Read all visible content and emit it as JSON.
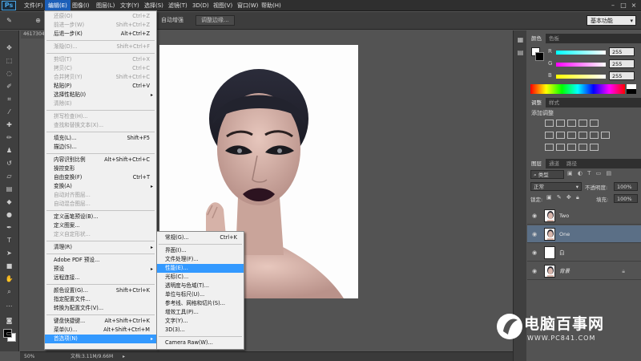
{
  "app": {
    "logo": "Ps"
  },
  "menubar": {
    "items": [
      "文件(F)",
      "编辑(E)",
      "图像(I)",
      "图层(L)",
      "文字(Y)",
      "选择(S)",
      "滤镜(T)",
      "3D(D)",
      "视图(V)",
      "窗口(W)",
      "帮助(H)"
    ],
    "active_index": 1
  },
  "options": {
    "auto_enhance": "自动增强",
    "refine_edge": "调整边缘...",
    "workspace": "基本功能"
  },
  "document": {
    "tab_label": "4617304",
    "zoom": "50%",
    "doc_info": "文档:3.11M/9.66M"
  },
  "edit_menu": [
    {
      "label": "还原(O)",
      "shortcut": "Ctrl+Z",
      "disabled": true
    },
    {
      "label": "前进一步(W)",
      "shortcut": "Shift+Ctrl+Z",
      "disabled": true
    },
    {
      "label": "后退一步(K)",
      "shortcut": "Alt+Ctrl+Z",
      "disabled": false
    },
    {
      "sep": true
    },
    {
      "label": "渐隐(D)...",
      "shortcut": "Shift+Ctrl+F",
      "disabled": true
    },
    {
      "sep": true
    },
    {
      "label": "剪切(T)",
      "shortcut": "Ctrl+X",
      "disabled": true
    },
    {
      "label": "拷贝(C)",
      "shortcut": "Ctrl+C",
      "disabled": true
    },
    {
      "label": "合并拷贝(Y)",
      "shortcut": "Shift+Ctrl+C",
      "disabled": true
    },
    {
      "label": "粘贴(P)",
      "shortcut": "Ctrl+V",
      "disabled": false
    },
    {
      "label": "选择性粘贴(I)",
      "shortcut": "",
      "disabled": false,
      "submenu": true
    },
    {
      "label": "清除(E)",
      "shortcut": "",
      "disabled": true
    },
    {
      "sep": true
    },
    {
      "label": "拼写检查(H)...",
      "shortcut": "",
      "disabled": true
    },
    {
      "label": "查找和替换文本(X)...",
      "shortcut": "",
      "disabled": true
    },
    {
      "sep": true
    },
    {
      "label": "填充(L)...",
      "shortcut": "Shift+F5",
      "disabled": false
    },
    {
      "label": "描边(S)...",
      "shortcut": "",
      "disabled": false
    },
    {
      "sep": true
    },
    {
      "label": "内容识别比例",
      "shortcut": "Alt+Shift+Ctrl+C",
      "disabled": false
    },
    {
      "label": "操控变形",
      "shortcut": "",
      "disabled": false
    },
    {
      "label": "自由变换(F)",
      "shortcut": "Ctrl+T",
      "disabled": false
    },
    {
      "label": "变换(A)",
      "shortcut": "",
      "disabled": false,
      "submenu": true
    },
    {
      "label": "自动对齐图层...",
      "shortcut": "",
      "disabled": true
    },
    {
      "label": "自动混合图层...",
      "shortcut": "",
      "disabled": true
    },
    {
      "sep": true
    },
    {
      "label": "定义画笔预设(B)...",
      "shortcut": "",
      "disabled": false
    },
    {
      "label": "定义图案...",
      "shortcut": "",
      "disabled": false
    },
    {
      "label": "定义自定形状...",
      "shortcut": "",
      "disabled": true
    },
    {
      "sep": true
    },
    {
      "label": "清理(R)",
      "shortcut": "",
      "disabled": false,
      "submenu": true
    },
    {
      "sep": true
    },
    {
      "label": "Adobe PDF 预设...",
      "shortcut": "",
      "disabled": false
    },
    {
      "label": "预设",
      "shortcut": "",
      "disabled": false,
      "submenu": true
    },
    {
      "label": "远程连接...",
      "shortcut": "",
      "disabled": false
    },
    {
      "sep": true
    },
    {
      "label": "颜色设置(G)...",
      "shortcut": "Shift+Ctrl+K",
      "disabled": false
    },
    {
      "label": "指定配置文件...",
      "shortcut": "",
      "disabled": false
    },
    {
      "label": "转换为配置文件(V)...",
      "shortcut": "",
      "disabled": false
    },
    {
      "sep": true
    },
    {
      "label": "键盘快捷键...",
      "shortcut": "Alt+Shift+Ctrl+K",
      "disabled": false
    },
    {
      "label": "菜单(U)...",
      "shortcut": "Alt+Shift+Ctrl+M",
      "disabled": false
    },
    {
      "label": "首选项(N)",
      "shortcut": "",
      "disabled": false,
      "submenu": true,
      "highlight": true
    }
  ],
  "prefs_submenu": [
    {
      "label": "常规(G)...",
      "shortcut": "Ctrl+K"
    },
    {
      "sep": true
    },
    {
      "label": "界面(I)...",
      "shortcut": ""
    },
    {
      "label": "文件处理(F)...",
      "shortcut": ""
    },
    {
      "label": "性能(E)...",
      "shortcut": "",
      "highlight": true
    },
    {
      "label": "光标(C)...",
      "shortcut": ""
    },
    {
      "label": "透明度与色域(T)...",
      "shortcut": ""
    },
    {
      "label": "单位与标尺(U)...",
      "shortcut": ""
    },
    {
      "label": "参考线、网格和切片(S)...",
      "shortcut": ""
    },
    {
      "label": "增效工具(P)...",
      "shortcut": ""
    },
    {
      "label": "文字(Y)...",
      "shortcut": ""
    },
    {
      "label": "3D(3)...",
      "shortcut": ""
    },
    {
      "sep": true
    },
    {
      "label": "Camera Raw(W)...",
      "shortcut": ""
    }
  ],
  "color_panel": {
    "tabs": [
      "颜色",
      "色板"
    ],
    "channels": [
      {
        "name": "R",
        "value": "255"
      },
      {
        "name": "G",
        "value": "255"
      },
      {
        "name": "B",
        "value": "255"
      }
    ]
  },
  "adjust_panel": {
    "tabs": [
      "调整",
      "样式"
    ],
    "title": "添加调整"
  },
  "layers_panel": {
    "tabs": [
      "图层",
      "通道",
      "路径"
    ],
    "filter_kind": "类型",
    "blend_mode": "正常",
    "opacity_label": "不透明度:",
    "opacity": "100%",
    "lock_label": "锁定:",
    "fill_label": "填充:",
    "fill": "100%",
    "layers": [
      {
        "name": "Two",
        "selected": false,
        "locked": false,
        "italic": false
      },
      {
        "name": "One",
        "selected": true,
        "locked": false,
        "italic": false
      },
      {
        "name": "白",
        "selected": false,
        "locked": false,
        "italic": false
      },
      {
        "name": "背景",
        "selected": false,
        "locked": true,
        "italic": true
      }
    ]
  },
  "watermark": {
    "title": "电脑百事网",
    "url": "WWW.PC841.COM"
  },
  "colors": {
    "menu_highlight": "#3399ff",
    "menubar_active": "#1c5fb8",
    "layer_selected": "#5b6f86"
  }
}
